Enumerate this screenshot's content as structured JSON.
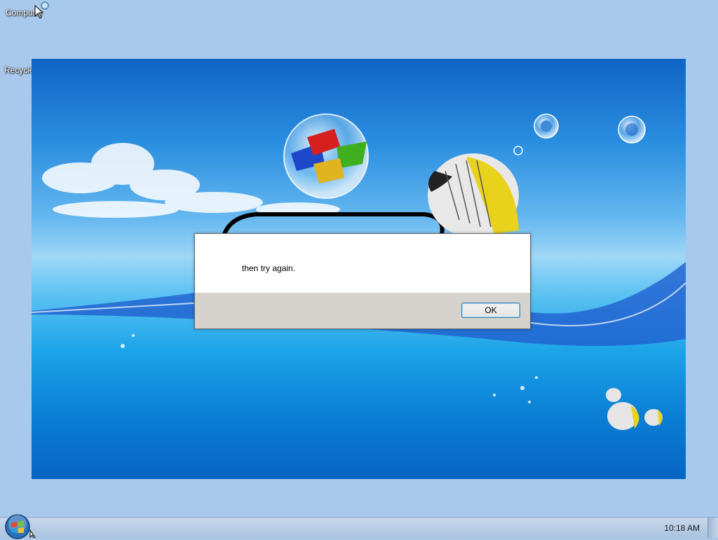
{
  "desktop": {
    "icons": [
      {
        "label": "Computer"
      },
      {
        "label": "Recycle Bin"
      }
    ]
  },
  "dialog": {
    "message": "then try again.",
    "ok_label": "OK"
  },
  "taskbar": {
    "clock": "10:18 AM"
  },
  "colors": {
    "desktop_background": "#a9c9ec",
    "dialog_footer": "#d6d3ce",
    "button_border": "#3c7fb1"
  }
}
